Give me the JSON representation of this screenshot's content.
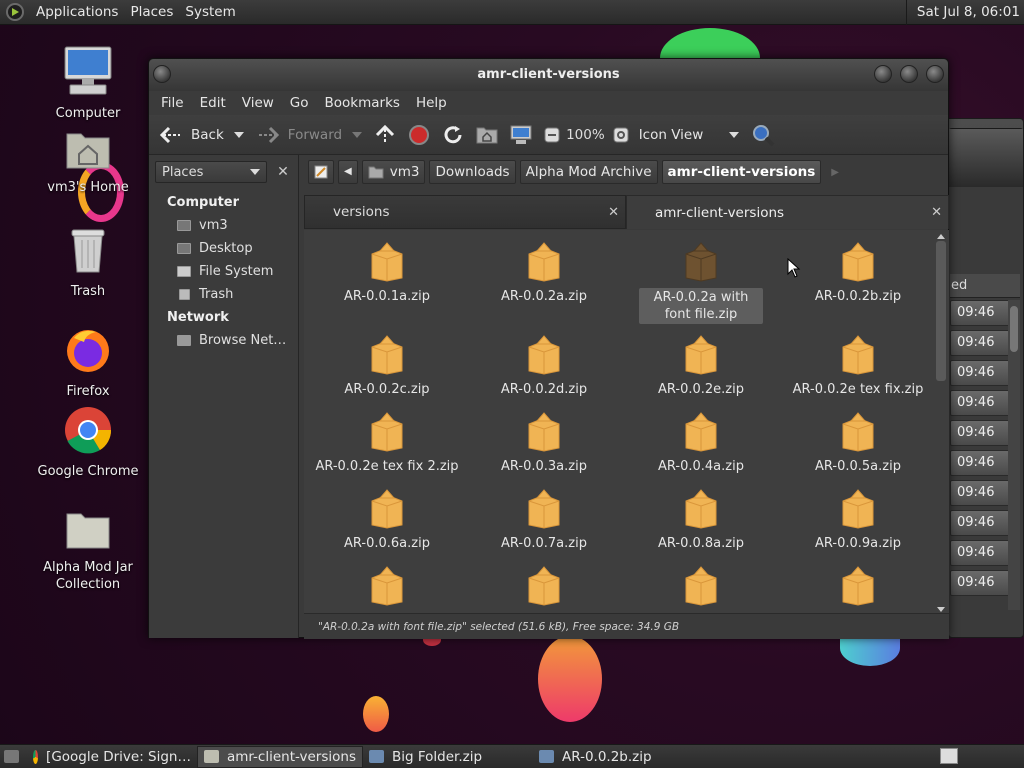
{
  "top_panel": {
    "menus": [
      "Applications",
      "Places",
      "System"
    ],
    "clock": "Sat Jul  8, 06:01"
  },
  "desktop": {
    "icons": [
      {
        "label": "Computer",
        "icon": "computer-icon"
      },
      {
        "label": "vm3's Home",
        "icon": "home-folder-icon"
      },
      {
        "label": "Trash",
        "icon": "trash-icon"
      },
      {
        "label": "Firefox",
        "icon": "firefox-icon"
      },
      {
        "label": "Google Chrome",
        "icon": "chrome-icon"
      },
      {
        "label": "Alpha Mod Jar Collection",
        "icon": "folder-icon"
      }
    ]
  },
  "window": {
    "title": "amr-client-versions",
    "menu": [
      "File",
      "Edit",
      "View",
      "Go",
      "Bookmarks",
      "Help"
    ],
    "toolbar": {
      "back": "Back",
      "forward": "Forward",
      "zoom": "100%",
      "view_mode": "Icon View"
    },
    "sidebar": {
      "selector": "Places",
      "sections": [
        {
          "heading": "Computer",
          "items": [
            "vm3",
            "Desktop",
            "File System",
            "Trash"
          ]
        },
        {
          "heading": "Network",
          "items": [
            "Browse Net…"
          ]
        }
      ]
    },
    "path": [
      "vm3",
      "Downloads",
      "Alpha Mod Archive",
      "amr-client-versions"
    ],
    "tabs": [
      {
        "label": "versions",
        "active": false
      },
      {
        "label": "amr-client-versions",
        "active": true
      }
    ],
    "files": [
      "AR-0.0.1a.zip",
      "AR-0.0.2a.zip",
      "AR-0.0.2a with font file.zip",
      "AR-0.0.2b.zip",
      "AR-0.0.2c.zip",
      "AR-0.0.2d.zip",
      "AR-0.0.2e.zip",
      "AR-0.0.2e tex fix.zip",
      "AR-0.0.2e tex fix 2.zip",
      "AR-0.0.3a.zip",
      "AR-0.0.4a.zip",
      "AR-0.0.5a.zip",
      "AR-0.0.6a.zip",
      "AR-0.0.7a.zip",
      "AR-0.0.8a.zip",
      "AR-0.0.9a.zip",
      "",
      "",
      "",
      ""
    ],
    "selected_file": "AR-0.0.2a with font file.zip",
    "status": "\"AR-0.0.2a with font file.zip\" selected (51.6 kB), Free space: 34.9 GB"
  },
  "background_window": {
    "column_fragment": "ed",
    "times": [
      "09:46",
      "09:46",
      "09:46",
      "09:46",
      "09:46",
      "09:46",
      "09:46",
      "09:46",
      "09:46",
      "09:46"
    ]
  },
  "taskbar": {
    "tasks": [
      "[Google Drive: Sign…",
      "amr-client-versions",
      "Big Folder.zip",
      "AR-0.0.2b.zip"
    ]
  },
  "colors": {
    "package": "#f0b454",
    "package_selected": "#6e5230",
    "desktop_bg": "#2a0a24"
  }
}
